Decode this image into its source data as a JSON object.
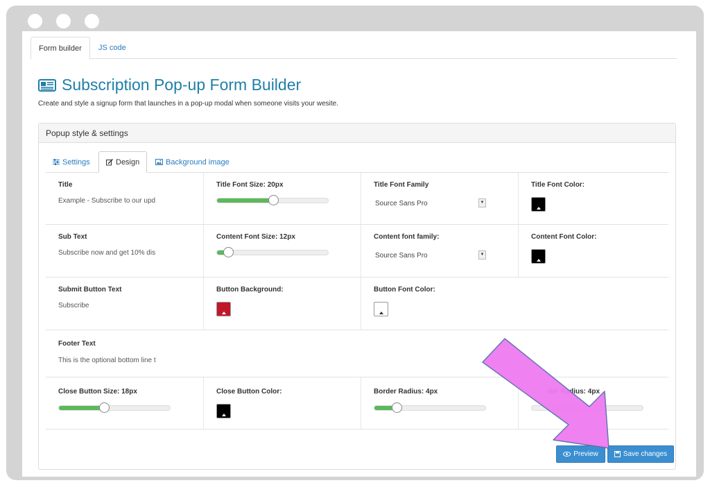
{
  "tabs": {
    "form_builder": "Form builder",
    "js_code": "JS code"
  },
  "page": {
    "title": "Subscription Pop-up Form Builder",
    "subtitle": "Create and style a signup form that launches in a pop-up modal when someone visits your wesite."
  },
  "panel": {
    "heading": "Popup style & settings",
    "tabs": {
      "settings": "Settings",
      "design": "Design",
      "background": "Background image"
    }
  },
  "fields": {
    "title": {
      "label": "Title",
      "value": "Example - Subscribe to our upd"
    },
    "title_font_size": {
      "label": "Title Font Size: 20px",
      "level": 0.5
    },
    "title_font_family": {
      "label": "Title Font Family",
      "value": "Source Sans Pro"
    },
    "title_font_color": {
      "label": "Title Font Color:",
      "color": "#000000"
    },
    "sub_text": {
      "label": "Sub Text",
      "value": "Subscribe now and get 10% dis"
    },
    "content_font_size": {
      "label": "Content Font Size: 12px",
      "level": 0.1
    },
    "content_font_family": {
      "label": "Content font family:",
      "value": "Source Sans Pro"
    },
    "content_font_color": {
      "label": "Content Font Color:",
      "color": "#000000"
    },
    "submit_text": {
      "label": "Submit Button Text",
      "value": "Subscribe"
    },
    "button_background": {
      "label": "Button Background:",
      "color": "#c0182a"
    },
    "button_font_color": {
      "label": "Button Font Color:",
      "color": "#ffffff"
    },
    "footer_text": {
      "label": "Footer Text",
      "value": "This is the optional bottom line t"
    },
    "close_button_size": {
      "label": "Close Button Size: 18px",
      "level": 0.4
    },
    "close_button_color": {
      "label": "Close Button Color:",
      "color": "#000000"
    },
    "border_radius": {
      "label": "Border Radius: 4px",
      "level": 0.2
    },
    "border_radius_2": {
      "label": "der Radius: 4px"
    }
  },
  "buttons": {
    "preview": "Preview",
    "save": "Save changes"
  },
  "colors": {
    "accent": "#1f7fa8",
    "link": "#2a7bbf",
    "slider_fill": "#5cb85c",
    "button": "#3b8fd0",
    "annotation_arrow": "#f07bf0"
  },
  "icons": {
    "title": "newspaper-icon",
    "settings": "sliders-icon",
    "design": "edit-icon",
    "background": "image-icon",
    "preview": "eye-icon",
    "save": "floppy-icon"
  }
}
